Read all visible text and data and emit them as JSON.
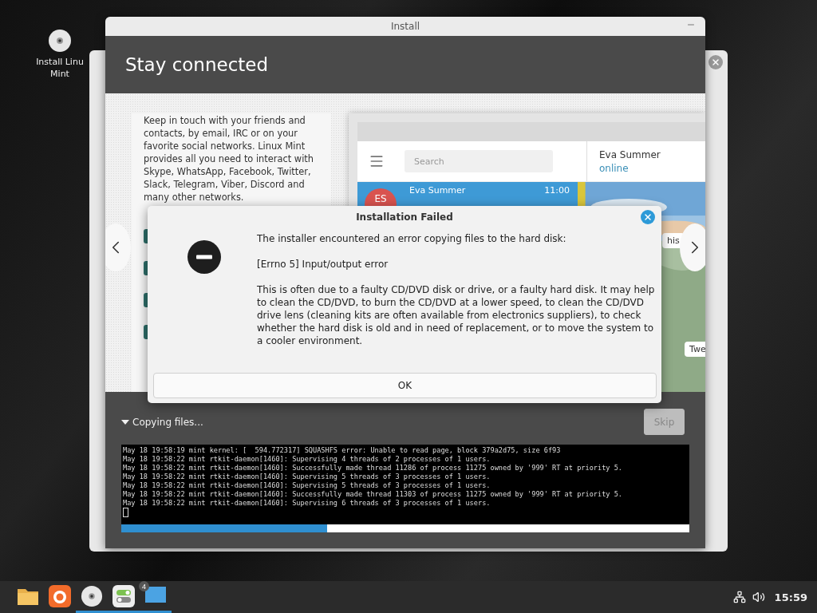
{
  "desktop_icon": {
    "label_lines": [
      "Install Linu",
      "Mint"
    ]
  },
  "window": {
    "title": "Install"
  },
  "header": {
    "title": "Stay connected"
  },
  "slide": {
    "text": "Keep in touch with your friends and contacts, by email, IRC or on your favorite social networks. Linux Mint provides all you need to interact with Skype, WhatsApp, Facebook, Twitter, Slack, Telegram, Viber, Discord and many other networks.",
    "mock": {
      "search": {
        "placeholder": "Search"
      },
      "contact": {
        "name": "Eva Summer",
        "status": "online"
      },
      "chats": [
        {
          "initials": "ES",
          "name": "Eva Summer",
          "time": "11:00",
          "selected": true
        }
      ],
      "message_fragments": [
        "his",
        "Twe"
      ]
    }
  },
  "dialog": {
    "title": "Installation Failed",
    "paragraphs": [
      "The installer encountered an error copying files to the hard disk:",
      "[Errno 5] Input/output error",
      "This is often due to a faulty CD/DVD disk or drive, or a faulty hard disk. It may help to clean the CD/DVD, to burn the CD/DVD at a lower speed, to clean the CD/DVD drive lens (cleaning kits are often available from electronics suppliers), to check whether the hard disk is old and in need of replacement, or to move the system to a cooler environment."
    ],
    "button": "OK"
  },
  "progress": {
    "label": "Copying files...",
    "expanded": true,
    "skip": {
      "label": "Skip",
      "disabled": true
    },
    "level": 0.362,
    "log": [
      "May 18 19:58:19 mint kernel: [  594.772317] SQUASHFS error: Unable to read page, block 379a2d75, size 6f93",
      "May 18 19:58:22 mint rtkit-daemon[1460]: Supervising 4 threads of 2 processes of 1 users.",
      "May 18 19:58:22 mint rtkit-daemon[1460]: Successfully made thread 11286 of process 11275 owned by '999' RT at priority 5.",
      "May 18 19:58:22 mint rtkit-daemon[1460]: Supervising 5 threads of 3 processes of 1 users.",
      "May 18 19:58:22 mint rtkit-daemon[1460]: Supervising 5 threads of 3 processes of 1 users.",
      "May 18 19:58:22 mint rtkit-daemon[1460]: Successfully made thread 11303 of process 11275 owned by '999' RT at priority 5.",
      "May 18 19:58:22 mint rtkit-daemon[1460]: Supervising 6 threads of 3 processes of 1 users."
    ]
  },
  "taskbar": {
    "apps": [
      {
        "kind": "folder",
        "running": false
      },
      {
        "kind": "firefox",
        "running": false
      },
      {
        "kind": "disc",
        "running": true
      },
      {
        "kind": "toggles",
        "running": true
      },
      {
        "kind": "window",
        "running": true,
        "badge": "4"
      }
    ],
    "clock": "15:59"
  }
}
